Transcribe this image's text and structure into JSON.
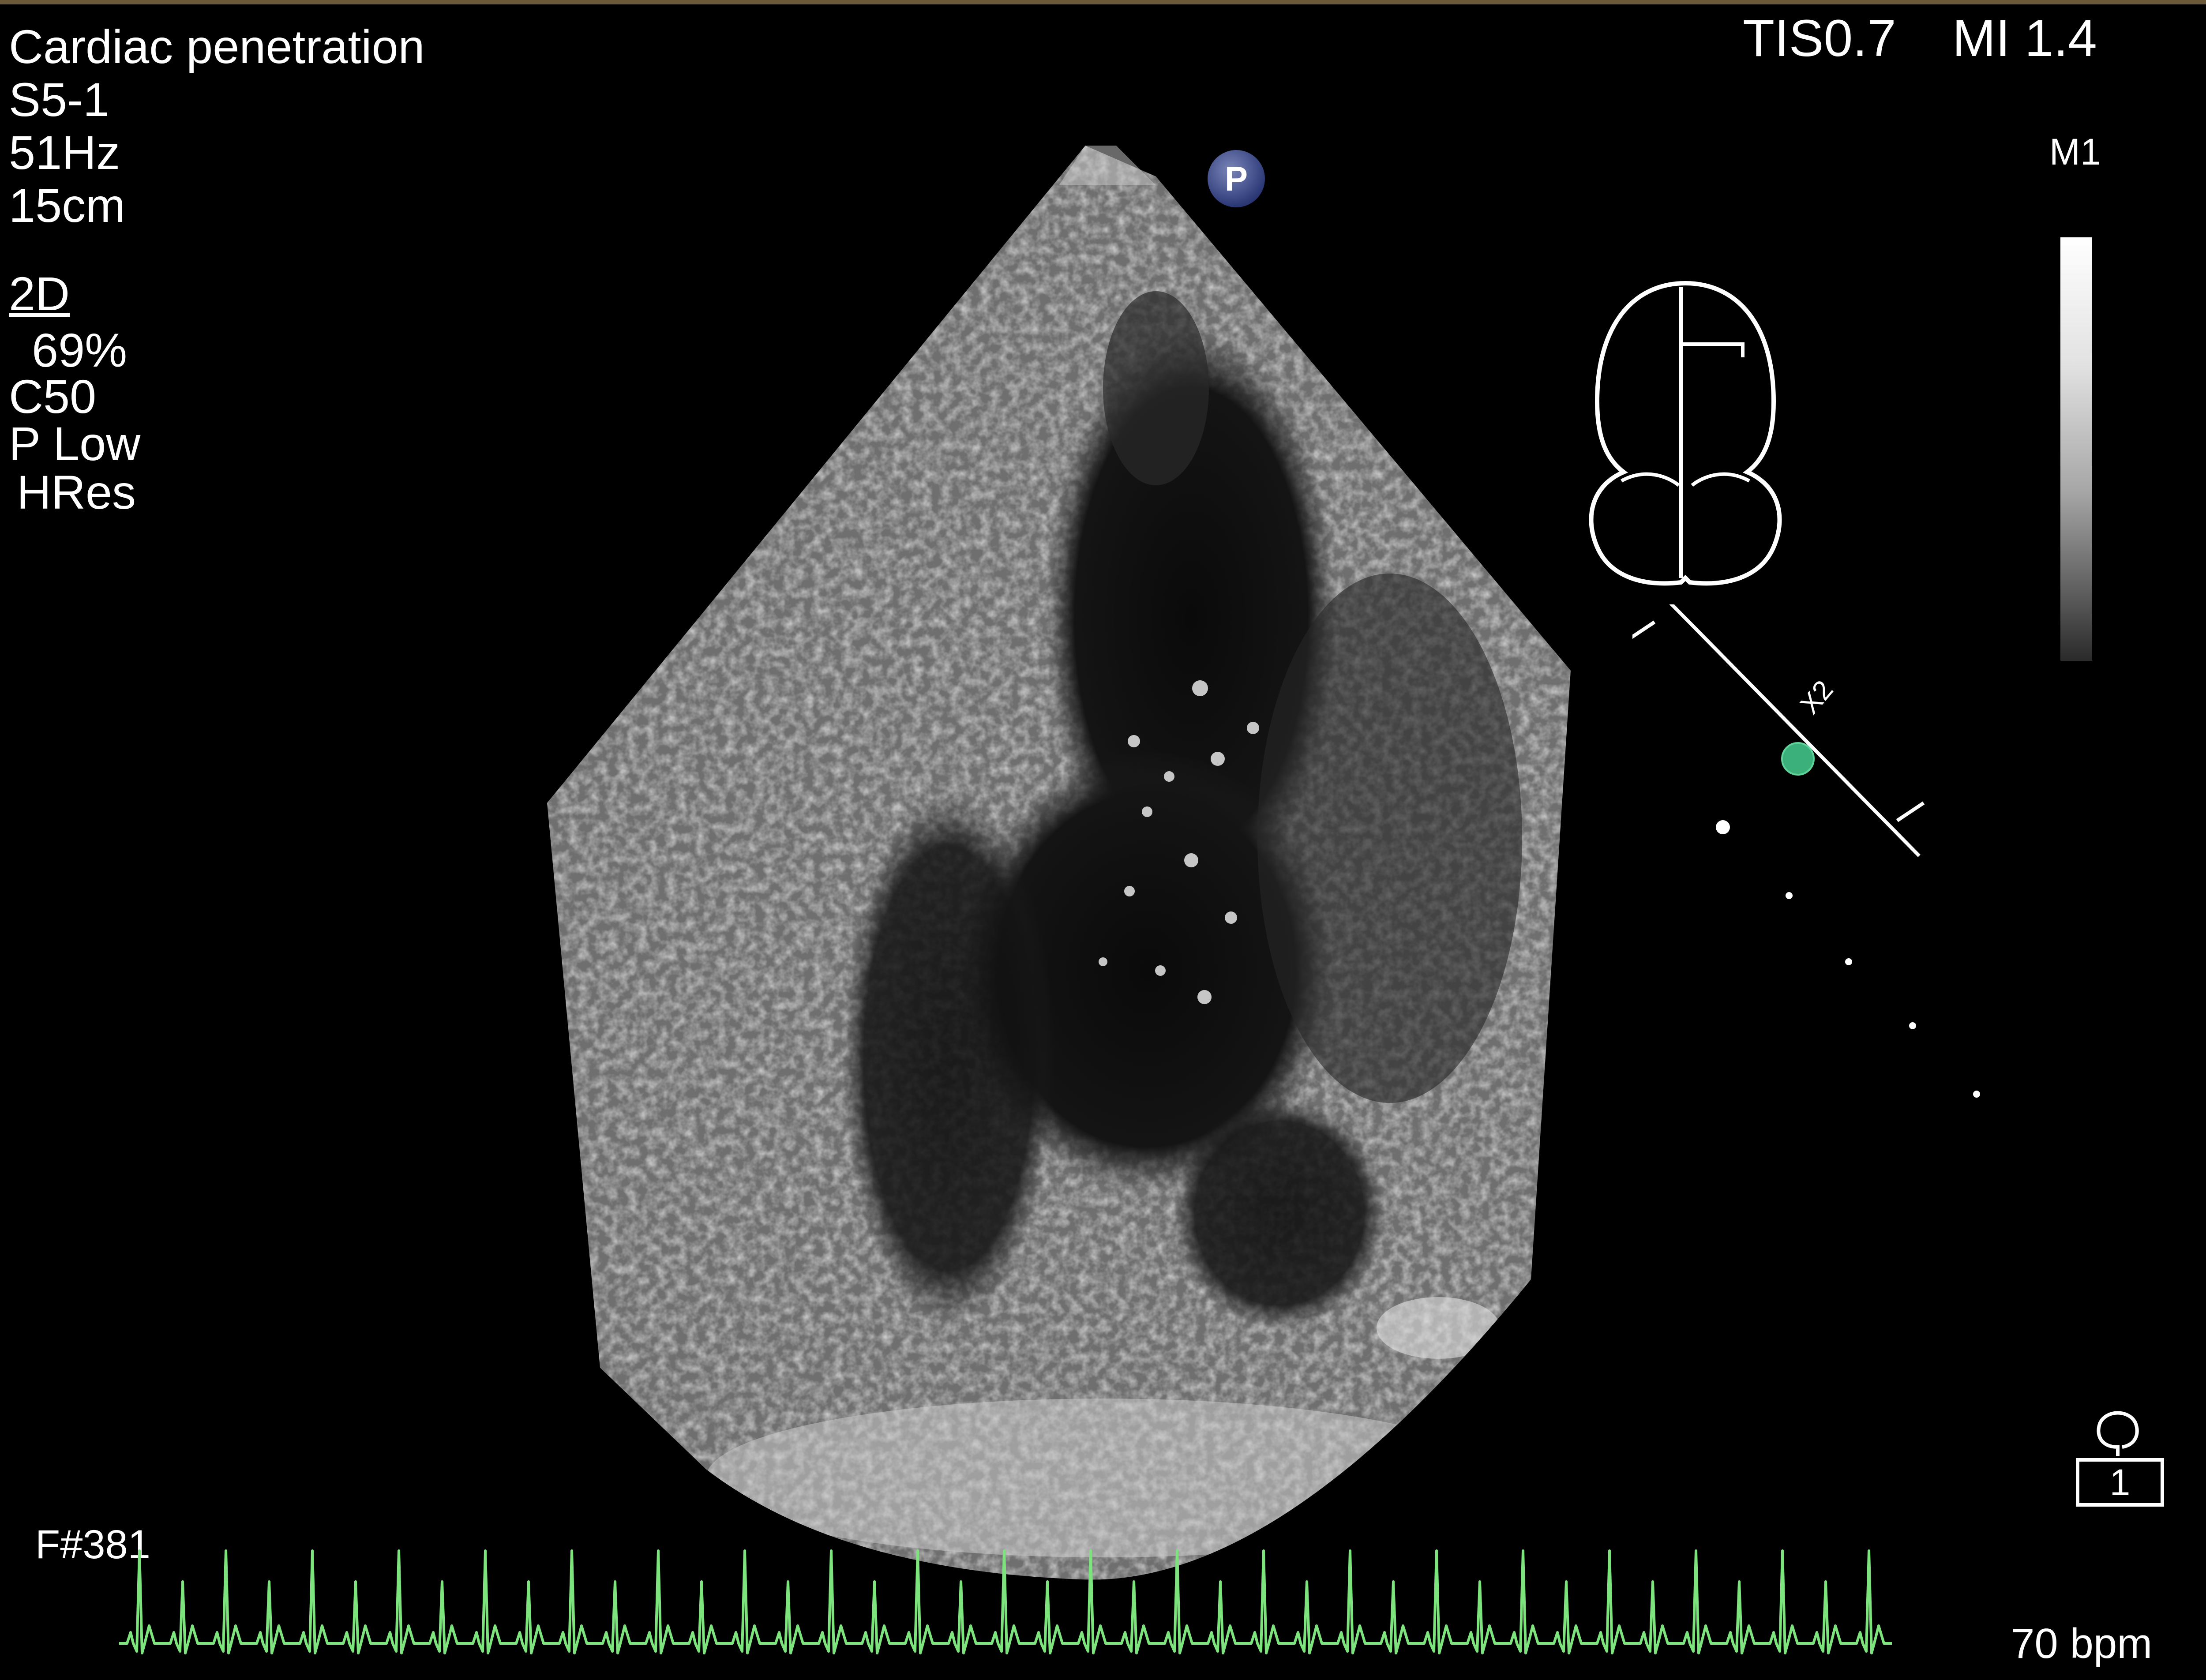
{
  "settings": {
    "preset": "Cardiac penetration",
    "probe": "S5-1",
    "frame_rate": "51Hz",
    "depth": "15cm",
    "mode": "2D",
    "gain": "69%",
    "compression": "C50",
    "power": "P Low",
    "resolution": "HRes"
  },
  "indices": {
    "tis": "TIS0.7",
    "mi": "MI 1.4"
  },
  "map": {
    "label": "M1"
  },
  "orientation": {
    "marker": "P"
  },
  "zoom": {
    "label": "X2"
  },
  "frame": {
    "number": "F#381"
  },
  "ecg": {
    "heart_rate": "70 bpm",
    "color": "#7de37d"
  },
  "cine": {
    "loop_number": "1"
  },
  "colors": {
    "background": "#000000",
    "text": "#ffffff",
    "ecg_trace": "#7de37d",
    "marker": "#3bb07a"
  }
}
